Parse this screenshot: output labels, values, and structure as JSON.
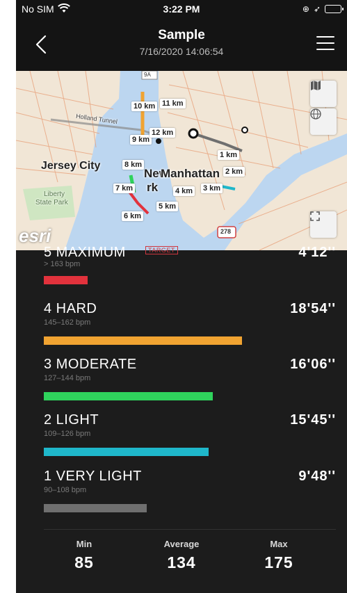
{
  "status_bar": {
    "carrier": "No SIM",
    "time": "3:22 PM",
    "icons": [
      "wifi-icon",
      "orientation-lock-icon",
      "location-arrow-icon",
      "battery-icon"
    ]
  },
  "nav": {
    "title": "Sample",
    "subtitle": "7/16/2020 14:06:54",
    "back_icon": "chevron-left-icon",
    "menu_icon": "hamburger-menu-icon"
  },
  "map": {
    "places": {
      "jersey_city": "Jersey City",
      "new_york_1": "New",
      "new_york_2": "rk",
      "manhattan": "Manhattan",
      "liberty_1": "Liberty",
      "liberty_2": "State Park",
      "holland_tunnel": "Holland Tunnel",
      "road_278": "278",
      "road_9a": "9A"
    },
    "km_labels": [
      "1 km",
      "2 km",
      "3 km",
      "4 km",
      "5 km",
      "6 km",
      "7 km",
      "8 km",
      "9 km",
      "10 km",
      "11 km",
      "12 km"
    ],
    "attribution": "esri",
    "buttons": [
      "map-layers-icon",
      "globe-icon",
      "fullscreen-icon"
    ]
  },
  "zones": [
    {
      "name": "5 MAXIMUM",
      "range": "> 163 bpm",
      "duration": "4'12''",
      "target": "TARGET",
      "color": "#e2323c",
      "fraction": 0.22
    },
    {
      "name": "4 HARD",
      "range": "145–162 bpm",
      "duration": "18'54''",
      "color": "#f0a331",
      "fraction": 1.0
    },
    {
      "name": "3 MODERATE",
      "range": "127–144 bpm",
      "duration": "16'06''",
      "color": "#2fd35c",
      "fraction": 0.852
    },
    {
      "name": "2 LIGHT",
      "range": "109–126 bpm",
      "duration": "15'45''",
      "color": "#1fb7ca",
      "fraction": 0.833
    },
    {
      "name": "1 VERY LIGHT",
      "range": "90–108 bpm",
      "duration": "9'48''",
      "color": "#6f6f6f",
      "fraction": 0.518
    }
  ],
  "stats": {
    "min_label": "Min",
    "min_value": "85",
    "avg_label": "Average",
    "avg_value": "134",
    "max_label": "Max",
    "max_value": "175"
  }
}
